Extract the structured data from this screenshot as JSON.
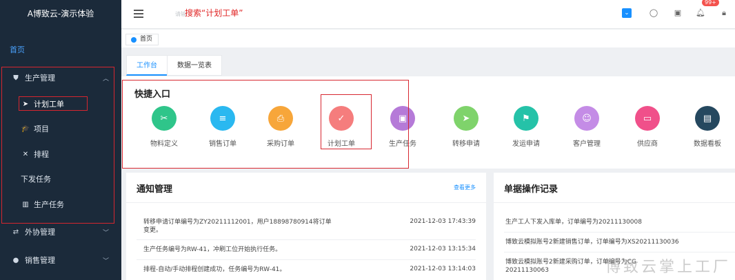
{
  "sidebar": {
    "title": "A博致云-演示体验",
    "home": "首页",
    "production": "生产管理",
    "plan_order": "计划工单",
    "project": "项目",
    "schedule": "排程",
    "dispatch": "下发任务",
    "prod_task": "生产任务",
    "outsourcing": "外协管理",
    "sales": "销售管理"
  },
  "header": {
    "hint_faint": "请输",
    "hint": "搜索“计划工单”",
    "badge": "99+"
  },
  "tagbar": {
    "home_tag": "首页"
  },
  "tabs": [
    "工作台",
    "数据一览表"
  ],
  "quick": {
    "title": "快捷入口",
    "items": [
      {
        "label": "物料定义",
        "color": "#2fc58a",
        "icon": "material-icon"
      },
      {
        "label": "销售订单",
        "color": "#2ab8f0",
        "icon": "sales-order-icon"
      },
      {
        "label": "采购订单",
        "color": "#f7a63a",
        "icon": "purchase-order-icon"
      },
      {
        "label": "计划工单",
        "color": "#f57d7d",
        "icon": "plan-order-icon"
      },
      {
        "label": "生产任务",
        "color": "#b57ad8",
        "icon": "production-task-icon"
      },
      {
        "label": "转移申请",
        "color": "#7fd36b",
        "icon": "transfer-icon"
      },
      {
        "label": "发运申请",
        "color": "#25c2a8",
        "icon": "shipping-icon"
      },
      {
        "label": "客户管理",
        "color": "#c48ce6",
        "icon": "customer-icon"
      },
      {
        "label": "供应商",
        "color": "#f0508a",
        "icon": "supplier-icon"
      },
      {
        "label": "数据看板",
        "color": "#25485f",
        "icon": "dashboard-icon"
      }
    ]
  },
  "notice": {
    "title": "通知管理",
    "more": "查看更多",
    "rows": [
      {
        "text": "转移申请订单编号为ZY20211112001，用户18898780914将订单变更。",
        "time": "2021-12-03 17:43:39"
      },
      {
        "text": "生产任务编号为RW-41，冲刷工位开始执行任务。",
        "time": "2021-12-03 13:15:34"
      },
      {
        "text": "排程-自动/手动排程创建成功，任务编号为RW-41。",
        "time": "2021-12-03 13:14:03"
      }
    ]
  },
  "records": {
    "title": "单据操作记录",
    "rows": [
      {
        "text": "生产工人下发入库单，订单编号为20211130008"
      },
      {
        "text": "博致云模拟账号2新建销售订单，订单编号为XS20211130036"
      },
      {
        "text": "博致云模拟账号2新建采购订单，订单编号为CG 20211130063"
      }
    ]
  },
  "watermark": "博致云掌上工厂"
}
